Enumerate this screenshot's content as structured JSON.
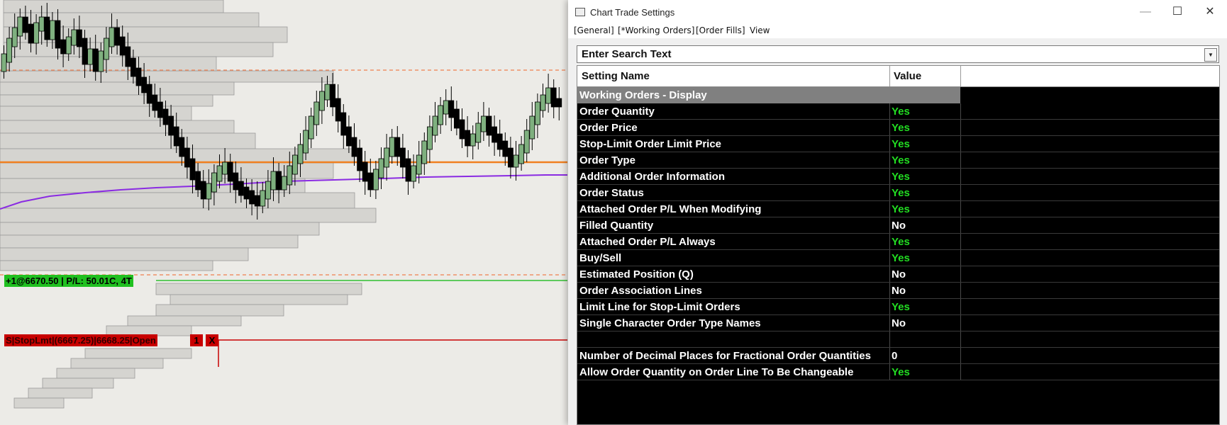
{
  "window": {
    "title": "Chart Trade Settings",
    "minimize_glyph": "—",
    "maximize_glyph": "☐",
    "close_glyph": "✕"
  },
  "menu": {
    "general": "[General]",
    "working_orders": "[*Working Orders]",
    "order_fills": "[Order Fills]",
    "view": "View"
  },
  "search": {
    "value": "Enter Search Text",
    "dropdown_glyph": "▼"
  },
  "grid": {
    "col_name": "Setting Name",
    "col_value": "Value",
    "section_title": "Working Orders - Display",
    "rows": [
      {
        "name": "Order Quantity",
        "value": "Yes"
      },
      {
        "name": "Order Price",
        "value": "Yes"
      },
      {
        "name": "Stop-Limit Order Limit Price",
        "value": "Yes"
      },
      {
        "name": "Order Type",
        "value": "Yes"
      },
      {
        "name": "Additional Order Information",
        "value": "Yes"
      },
      {
        "name": "Order Status",
        "value": "Yes"
      },
      {
        "name": "Attached Order P/L When Modifying",
        "value": "Yes"
      },
      {
        "name": "Filled Quantity",
        "value": "No"
      },
      {
        "name": "Attached Order P/L Always",
        "value": "Yes"
      },
      {
        "name": "Buy/Sell",
        "value": "Yes"
      },
      {
        "name": "Estimated Position (Q)",
        "value": "No"
      },
      {
        "name": "Order Association Lines",
        "value": "No"
      },
      {
        "name": "Limit Line for Stop-Limit Orders",
        "value": "Yes"
      },
      {
        "name": "Single Character Order Type Names",
        "value": "No"
      },
      {
        "name": "",
        "value": ""
      },
      {
        "name": "Number of Decimal Places for Fractional Order Quantities",
        "value": "0"
      },
      {
        "name": "Allow Order Quantity on Order Line To Be Changeable",
        "value": "Yes"
      }
    ]
  },
  "chart": {
    "position_label": "+1@6670.50 | P/L: 50.01C, 4T",
    "stop_label": "S|StopLmt|(6667.25)|6668.25|Open",
    "stop_qty": "1",
    "stop_close": "X"
  },
  "colors": {
    "yes": "#22dd22",
    "no": "#ffffff",
    "candle_up": "#7fb07f",
    "candle_down": "#000000",
    "orange_line": "#f08020",
    "purple_line": "#8a2be2",
    "position_bg": "#20c020",
    "stop_bg": "#c80000"
  }
}
